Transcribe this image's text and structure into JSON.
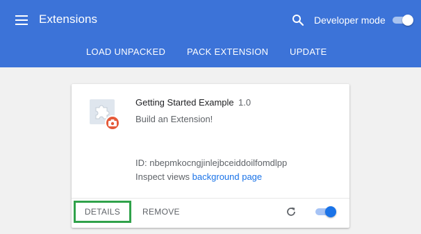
{
  "header": {
    "title": "Extensions",
    "developer_mode_label": "Developer mode",
    "developer_mode_on": true,
    "icons": {
      "menu": "hamburger-menu-icon",
      "search": "search-icon"
    }
  },
  "toolbar": {
    "load_unpacked": "LOAD UNPACKED",
    "pack_extension": "PACK EXTENSION",
    "update": "UPDATE"
  },
  "extension_card": {
    "name": "Getting Started Example",
    "version": "1.0",
    "description": "Build an Extension!",
    "id_text": "ID: nbepmkocngjinlejbceiddoilfomdlpp",
    "inspect_label": "Inspect views",
    "inspect_link": "background page",
    "details_label": "DETAILS",
    "remove_label": "REMOVE",
    "enabled": true,
    "icons": {
      "extension": "puzzle-piece-icon",
      "badge": "camera-badge-icon",
      "reload": "reload-icon"
    }
  },
  "colors": {
    "header_bg": "#3c73d8",
    "page_bg": "#f1f1f1",
    "link": "#1a73e8",
    "details_highlight": "#30a24a",
    "badge": "#e55a3a"
  }
}
